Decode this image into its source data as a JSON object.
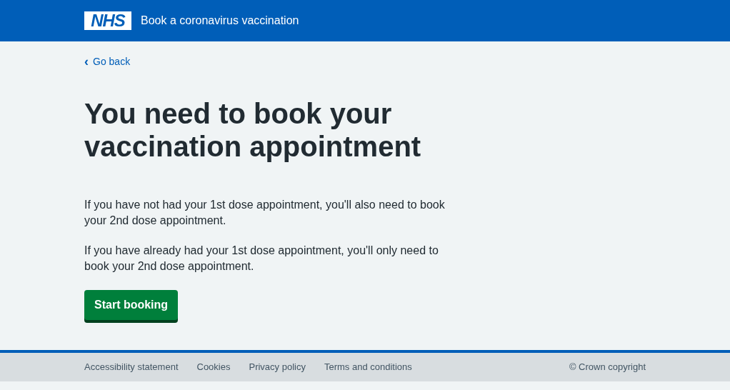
{
  "header": {
    "logo": "NHS",
    "service_name": "Book a coronavirus vaccination"
  },
  "back_link": {
    "icon": "‹",
    "label": "Go back"
  },
  "heading": "You need to book your vaccination appointment",
  "paragraphs": [
    "If you have not had your 1st dose appointment, you'll also need to book your 2nd dose appointment.",
    "If you have already had your 1st dose appointment, you'll only need to book your 2nd dose appointment."
  ],
  "start_button": "Start booking",
  "footer": {
    "links": [
      "Accessibility statement",
      "Cookies",
      "Privacy policy",
      "Terms and conditions"
    ],
    "copyright": "© Crown copyright"
  }
}
